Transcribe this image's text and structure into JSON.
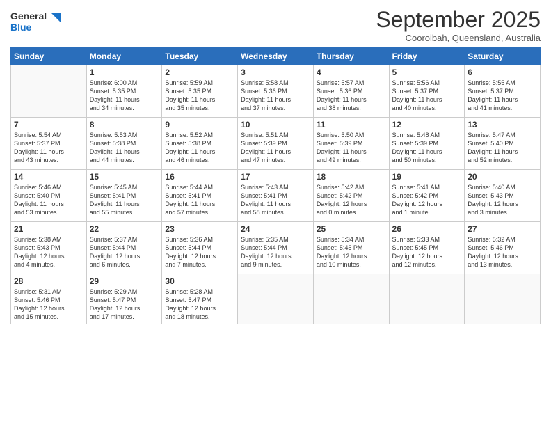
{
  "header": {
    "logo_line1": "General",
    "logo_line2": "Blue",
    "month": "September 2025",
    "location": "Cooroibah, Queensland, Australia"
  },
  "weekdays": [
    "Sunday",
    "Monday",
    "Tuesday",
    "Wednesday",
    "Thursday",
    "Friday",
    "Saturday"
  ],
  "weeks": [
    [
      {
        "day": "",
        "text": ""
      },
      {
        "day": "1",
        "text": "Sunrise: 6:00 AM\nSunset: 5:35 PM\nDaylight: 11 hours\nand 34 minutes."
      },
      {
        "day": "2",
        "text": "Sunrise: 5:59 AM\nSunset: 5:35 PM\nDaylight: 11 hours\nand 35 minutes."
      },
      {
        "day": "3",
        "text": "Sunrise: 5:58 AM\nSunset: 5:36 PM\nDaylight: 11 hours\nand 37 minutes."
      },
      {
        "day": "4",
        "text": "Sunrise: 5:57 AM\nSunset: 5:36 PM\nDaylight: 11 hours\nand 38 minutes."
      },
      {
        "day": "5",
        "text": "Sunrise: 5:56 AM\nSunset: 5:37 PM\nDaylight: 11 hours\nand 40 minutes."
      },
      {
        "day": "6",
        "text": "Sunrise: 5:55 AM\nSunset: 5:37 PM\nDaylight: 11 hours\nand 41 minutes."
      }
    ],
    [
      {
        "day": "7",
        "text": "Sunrise: 5:54 AM\nSunset: 5:37 PM\nDaylight: 11 hours\nand 43 minutes."
      },
      {
        "day": "8",
        "text": "Sunrise: 5:53 AM\nSunset: 5:38 PM\nDaylight: 11 hours\nand 44 minutes."
      },
      {
        "day": "9",
        "text": "Sunrise: 5:52 AM\nSunset: 5:38 PM\nDaylight: 11 hours\nand 46 minutes."
      },
      {
        "day": "10",
        "text": "Sunrise: 5:51 AM\nSunset: 5:39 PM\nDaylight: 11 hours\nand 47 minutes."
      },
      {
        "day": "11",
        "text": "Sunrise: 5:50 AM\nSunset: 5:39 PM\nDaylight: 11 hours\nand 49 minutes."
      },
      {
        "day": "12",
        "text": "Sunrise: 5:48 AM\nSunset: 5:39 PM\nDaylight: 11 hours\nand 50 minutes."
      },
      {
        "day": "13",
        "text": "Sunrise: 5:47 AM\nSunset: 5:40 PM\nDaylight: 11 hours\nand 52 minutes."
      }
    ],
    [
      {
        "day": "14",
        "text": "Sunrise: 5:46 AM\nSunset: 5:40 PM\nDaylight: 11 hours\nand 53 minutes."
      },
      {
        "day": "15",
        "text": "Sunrise: 5:45 AM\nSunset: 5:41 PM\nDaylight: 11 hours\nand 55 minutes."
      },
      {
        "day": "16",
        "text": "Sunrise: 5:44 AM\nSunset: 5:41 PM\nDaylight: 11 hours\nand 57 minutes."
      },
      {
        "day": "17",
        "text": "Sunrise: 5:43 AM\nSunset: 5:41 PM\nDaylight: 11 hours\nand 58 minutes."
      },
      {
        "day": "18",
        "text": "Sunrise: 5:42 AM\nSunset: 5:42 PM\nDaylight: 12 hours\nand 0 minutes."
      },
      {
        "day": "19",
        "text": "Sunrise: 5:41 AM\nSunset: 5:42 PM\nDaylight: 12 hours\nand 1 minute."
      },
      {
        "day": "20",
        "text": "Sunrise: 5:40 AM\nSunset: 5:43 PM\nDaylight: 12 hours\nand 3 minutes."
      }
    ],
    [
      {
        "day": "21",
        "text": "Sunrise: 5:38 AM\nSunset: 5:43 PM\nDaylight: 12 hours\nand 4 minutes."
      },
      {
        "day": "22",
        "text": "Sunrise: 5:37 AM\nSunset: 5:44 PM\nDaylight: 12 hours\nand 6 minutes."
      },
      {
        "day": "23",
        "text": "Sunrise: 5:36 AM\nSunset: 5:44 PM\nDaylight: 12 hours\nand 7 minutes."
      },
      {
        "day": "24",
        "text": "Sunrise: 5:35 AM\nSunset: 5:44 PM\nDaylight: 12 hours\nand 9 minutes."
      },
      {
        "day": "25",
        "text": "Sunrise: 5:34 AM\nSunset: 5:45 PM\nDaylight: 12 hours\nand 10 minutes."
      },
      {
        "day": "26",
        "text": "Sunrise: 5:33 AM\nSunset: 5:45 PM\nDaylight: 12 hours\nand 12 minutes."
      },
      {
        "day": "27",
        "text": "Sunrise: 5:32 AM\nSunset: 5:46 PM\nDaylight: 12 hours\nand 13 minutes."
      }
    ],
    [
      {
        "day": "28",
        "text": "Sunrise: 5:31 AM\nSunset: 5:46 PM\nDaylight: 12 hours\nand 15 minutes."
      },
      {
        "day": "29",
        "text": "Sunrise: 5:29 AM\nSunset: 5:47 PM\nDaylight: 12 hours\nand 17 minutes."
      },
      {
        "day": "30",
        "text": "Sunrise: 5:28 AM\nSunset: 5:47 PM\nDaylight: 12 hours\nand 18 minutes."
      },
      {
        "day": "",
        "text": ""
      },
      {
        "day": "",
        "text": ""
      },
      {
        "day": "",
        "text": ""
      },
      {
        "day": "",
        "text": ""
      }
    ]
  ]
}
